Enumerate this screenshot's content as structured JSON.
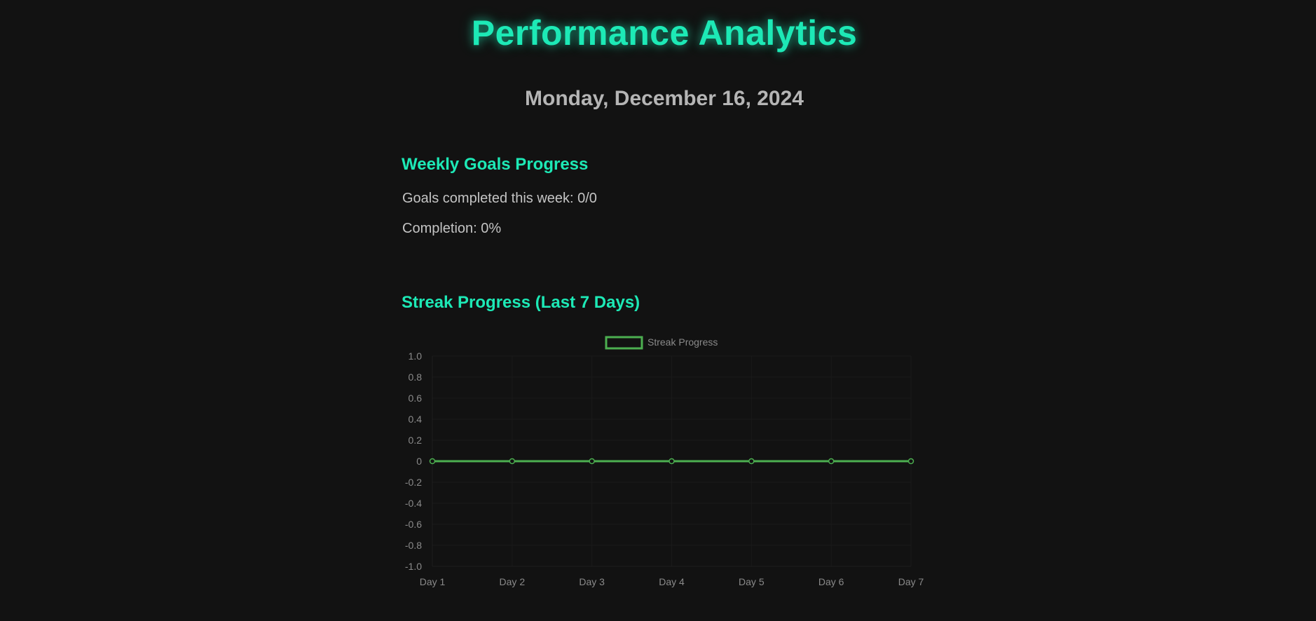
{
  "header": {
    "title": "Performance Analytics",
    "date": "Monday, December 16, 2024"
  },
  "weekly_goals": {
    "heading": "Weekly Goals Progress",
    "completed_label": "Goals completed this week: 0/0",
    "completion_label": "Completion: 0%"
  },
  "streak": {
    "heading": "Streak Progress (Last 7 Days)"
  },
  "colors": {
    "background": "#121212",
    "accent": "#1de9b6",
    "series": "#4caf50",
    "muted_text": "#8a8a8a"
  },
  "chart_data": {
    "type": "line",
    "title": "",
    "xlabel": "",
    "ylabel": "",
    "categories": [
      "Day 1",
      "Day 2",
      "Day 3",
      "Day 4",
      "Day 5",
      "Day 6",
      "Day 7"
    ],
    "series": [
      {
        "name": "Streak Progress",
        "values": [
          0,
          0,
          0,
          0,
          0,
          0,
          0
        ],
        "color": "#4caf50"
      }
    ],
    "ylim": [
      -1.0,
      1.0
    ],
    "yticks": [
      "1.0",
      "0.8",
      "0.6",
      "0.4",
      "0.2",
      "0",
      "-0.2",
      "-0.4",
      "-0.6",
      "-0.8",
      "-1.0"
    ],
    "legend": "top-center",
    "grid": true
  }
}
